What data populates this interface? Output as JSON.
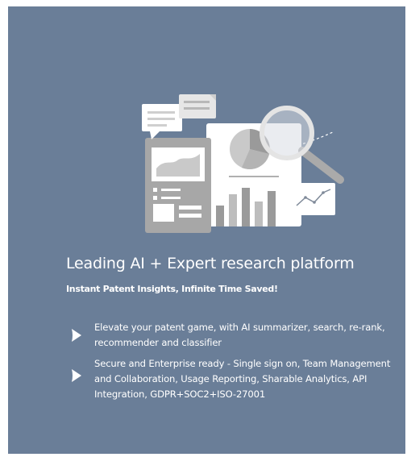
{
  "panel": {
    "background": "#6a7e98",
    "illustration_icon": "research-analytics-illustration",
    "headline": "Leading AI + Expert research platform",
    "subheadline": "Instant Patent Insights, Infinite Time Saved!",
    "features": [
      {
        "icon": "play-arrow-icon",
        "text": "Elevate your patent game, with AI summarizer, search, re-rank, recommender and classifier"
      },
      {
        "icon": "play-arrow-icon",
        "text": "Secure and Enterprise ready - Single sign on, Team Management and Collaboration, Usage Reporting, Sharable Analytics, API Integration, GDPR+SOC2+ISO-27001"
      }
    ]
  }
}
